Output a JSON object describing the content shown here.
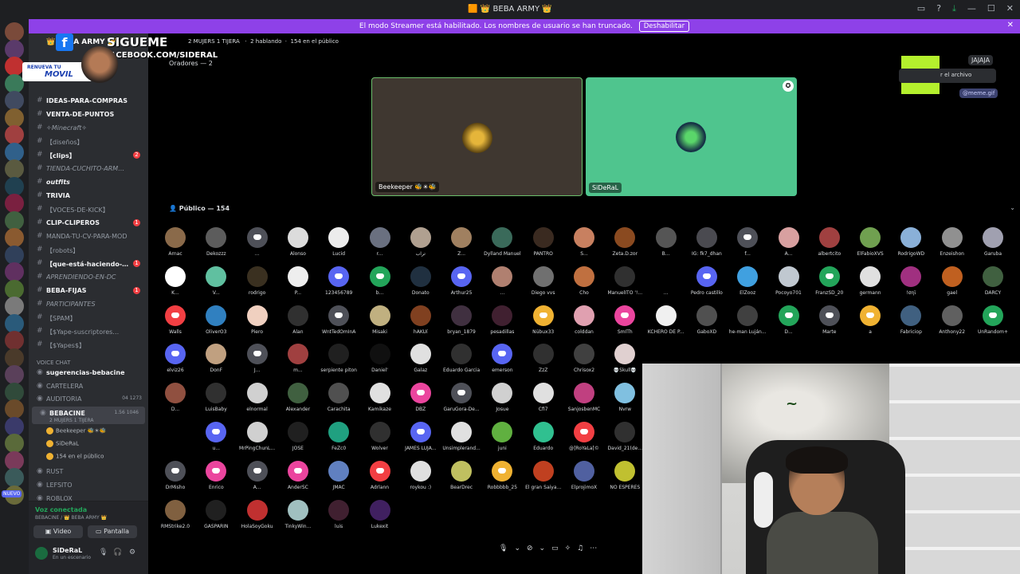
{
  "window": {
    "title": "🟧 👑 BEBA ARMY 👑"
  },
  "streamer_banner": {
    "text": "El modo Streamer está habilitado. Los nombres de usuario se han truncado.",
    "button": "Deshabilitar"
  },
  "overlay": {
    "sigueme": "SIGUEME",
    "facebook": "FACEBOOK.COM/SIDERAL",
    "renueva": "RENUEVA TU",
    "movil": "MOVIL"
  },
  "sidebar": {
    "server_name": "👑 BEBA ARMY 👑",
    "channels": [
      {
        "name": "IDEAS-PARA-COMPRAS",
        "style": "bold"
      },
      {
        "name": "VENTA-DE-PUNTOS",
        "style": "bold"
      },
      {
        "name": "✧Minecraft✧",
        "style": "ital"
      },
      {
        "name": "【diseños】",
        "style": ""
      },
      {
        "name": "【clips】",
        "style": "bold",
        "count": "2"
      },
      {
        "name": "TIENDA-CUCHITO-ARM…",
        "style": "ital"
      },
      {
        "name": "outfits",
        "style": "bold ital"
      },
      {
        "name": "TRIVIA",
        "style": "bold"
      },
      {
        "name": "【VOCES-DE-KICK】",
        "style": ""
      },
      {
        "name": "CLIP-CLIPEROS",
        "style": "bold",
        "count": "1"
      },
      {
        "name": "MANDA-TU-CV-PARA-MOD",
        "style": ""
      },
      {
        "name": "【robots】",
        "style": ""
      },
      {
        "name": "【que-está-haciendo-…",
        "style": "bold",
        "count": "1"
      },
      {
        "name": "APRENDIENDO-EN-DC",
        "style": "ital"
      },
      {
        "name": "BEBA-FIJAS",
        "style": "bold",
        "count": "1"
      },
      {
        "name": "PARTICIPANTES",
        "style": "ital"
      },
      {
        "name": "【SPAM】",
        "style": ""
      },
      {
        "name": "【$Yape-suscriptores…",
        "style": ""
      },
      {
        "name": "【$Yapes$】",
        "style": ""
      }
    ],
    "voice_category": "VOICE CHAT",
    "voice_channels": [
      {
        "name": "sugerencias-bebacine",
        "bold": true
      },
      {
        "name": "CARTELERA",
        "bold": false
      },
      {
        "name": "AUDITORIA",
        "bold": false,
        "num": "04 1273"
      },
      {
        "name": "BEBACINE",
        "bold": true,
        "num": "1.56 1046",
        "sub": "2 MUJERS 1 TIJERA"
      }
    ],
    "voice_users": [
      "Beekeeper 🐝☀🐝",
      "SiDeRaL",
      "154 en el público"
    ],
    "more_channels": [
      "RUST",
      "LEFSITO",
      "ROBLOX"
    ]
  },
  "voice_panel": {
    "connected": "Voz conectada",
    "location": "BEBACINE / 👑 BEBA ARMY 👑",
    "video": "Video",
    "screen": "Pantalla"
  },
  "user_panel": {
    "name": "SiDeRaL",
    "status": "En un escenario"
  },
  "stage": {
    "topic": "2 MUJERS 1 TIJERA",
    "talking": "2 hablando",
    "audience_count": "154 en el público",
    "speakers_header": "Oradores — 2",
    "speakers": [
      "Beekeeper 🐝☀🐝",
      "SiDeRaL"
    ],
    "public_header": "Público — 154"
  },
  "chat_bits": {
    "jajaja": "JAJAJA",
    "file": "r el archivo",
    "meme": "@meme.gif"
  },
  "audience": [
    {
      "n": "Arnac",
      "c": "#8a6a4a"
    },
    {
      "n": "Dekozzz",
      "c": "#5c5c5c"
    },
    {
      "n": "...",
      "c": "#4e5058",
      "d": true
    },
    {
      "n": "Alonso",
      "c": "#dcdcdc"
    },
    {
      "n": "Lucid",
      "c": "#ececec"
    },
    {
      "n": "r...",
      "c": "#6a7080"
    },
    {
      "n": "تراب",
      "c": "#b0a090"
    },
    {
      "n": "Z...",
      "c": "#a08060"
    },
    {
      "n": "Dylland Manuel",
      "c": "#3a6a5a"
    },
    {
      "n": "PANTRO",
      "c": "#3a2a20"
    },
    {
      "n": "S...",
      "c": "#c88060"
    },
    {
      "n": "Zeta.D.zor",
      "c": "#8a4a20"
    },
    {
      "n": "B...",
      "c": "#555555"
    },
    {
      "n": "IG: fk7_dhan",
      "c": "#4a4a50"
    },
    {
      "n": "f...",
      "c": "#4e5058",
      "d": true
    },
    {
      "n": "A...",
      "c": "#d8a0a0"
    },
    {
      "n": "albertcito",
      "c": "#a04040"
    },
    {
      "n": "ElFabioXVS",
      "c": "#70a050"
    },
    {
      "n": "RodrigoWD",
      "c": "#8ab0d8"
    },
    {
      "n": "Enzeishon",
      "c": "#909090"
    },
    {
      "n": "Garuba",
      "c": "#a0a0b0"
    },
    {
      "n": "K...",
      "c": "#ffffff"
    },
    {
      "n": "V...",
      "c": "#60c0a0"
    },
    {
      "n": "rodrigo",
      "c": "#3a3020"
    },
    {
      "n": "P...",
      "c": "#eeeeee"
    },
    {
      "n": "123456789",
      "c": "#5865f2",
      "d": true
    },
    {
      "n": "b...",
      "c": "#23a55a",
      "d": true
    },
    {
      "n": "Donato",
      "c": "#203040"
    },
    {
      "n": "Arthur25",
      "c": "#5865f2",
      "d": true
    },
    {
      "n": "...",
      "c": "#b08070"
    },
    {
      "n": "Diego vvs",
      "c": "#707070"
    },
    {
      "n": "Cho",
      "c": "#c07040"
    },
    {
      "n": "ManuelITO '!...",
      "c": "#303030"
    },
    {
      "n": "...",
      "c": "#000000"
    },
    {
      "n": "Pedro castillo",
      "c": "#5865f2",
      "d": true
    },
    {
      "n": "ElZooz",
      "c": "#40a0e0"
    },
    {
      "n": "Pocoyo701",
      "c": "#c0c8d0"
    },
    {
      "n": "FranzSD_20",
      "c": "#23a55a",
      "d": true
    },
    {
      "n": "germann",
      "c": "#e0e0e0"
    },
    {
      "n": "!σηϊ",
      "c": "#a03080"
    },
    {
      "n": "gael",
      "c": "#c06020"
    },
    {
      "n": "DARCY",
      "c": "#406040"
    },
    {
      "n": "Walls",
      "c": "#f23f43",
      "d": true
    },
    {
      "n": "OliverO3",
      "c": "#3080c0"
    },
    {
      "n": "Piero",
      "c": "#f0d0c0"
    },
    {
      "n": "Alan",
      "c": "#303030"
    },
    {
      "n": "WntTedOmInA",
      "c": "#4e5058",
      "d": true
    },
    {
      "n": "Misaki",
      "c": "#c0b080"
    },
    {
      "n": "hAKUí",
      "c": "#804020"
    },
    {
      "n": "bryan_1879",
      "c": "#403040"
    },
    {
      "n": "pesadillas",
      "c": "#402030"
    },
    {
      "n": "Nübux33",
      "c": "#f0b232",
      "d": true
    },
    {
      "n": "colddan",
      "c": "#e0a0b0"
    },
    {
      "n": "SmITh",
      "c": "#eb459e",
      "d": true
    },
    {
      "n": "KCHERO DE P...",
      "c": "#f0f0f0"
    },
    {
      "n": "GaboXD",
      "c": "#505050"
    },
    {
      "n": "he-man Luján...",
      "c": "#404040"
    },
    {
      "n": "D...",
      "c": "#23a55a",
      "d": true
    },
    {
      "n": "Marte",
      "c": "#4e5058",
      "d": true
    },
    {
      "n": "a",
      "c": "#f0b232",
      "d": true
    },
    {
      "n": "Fabriciop",
      "c": "#406080"
    },
    {
      "n": "Anthony22",
      "c": "#606060"
    },
    {
      "n": "UnRandom+",
      "c": "#23a55a",
      "d": true
    },
    {
      "n": "elviz26",
      "c": "#5865f2",
      "d": true
    },
    {
      "n": "DonF",
      "c": "#c0a080"
    },
    {
      "n": "J...",
      "c": "#4e5058",
      "d": true
    },
    {
      "n": "m...",
      "c": "#a04040"
    },
    {
      "n": "serpiente piton",
      "c": "#202020"
    },
    {
      "n": "Daniel'",
      "c": "#101010"
    },
    {
      "n": "Galaz",
      "c": "#e0e0e0"
    },
    {
      "n": "Eduardo Garcia",
      "c": "#303030"
    },
    {
      "n": "emerson",
      "c": "#5865f2",
      "d": true
    },
    {
      "n": "ZzZ",
      "c": "#303030"
    },
    {
      "n": "Chrisox2",
      "c": "#404040"
    },
    {
      "n": "💀Skull💀",
      "c": "#e0d0d0"
    },
    {
      "n": "D...",
      "c": "#905040"
    },
    {
      "n": "LuisBaby",
      "c": "#303030"
    },
    {
      "n": "elnormal",
      "c": "#d0d0d0"
    },
    {
      "n": "Alexander",
      "c": "#406040"
    },
    {
      "n": "Carachita",
      "c": "#505050"
    },
    {
      "n": "Kamikaze",
      "c": "#e0e0e0"
    },
    {
      "n": "DBZ",
      "c": "#eb459e",
      "d": true
    },
    {
      "n": "GaruGora-De...",
      "c": "#4e5058",
      "d": true
    },
    {
      "n": "Josue",
      "c": "#d0d0d0"
    },
    {
      "n": "Cfi7",
      "c": "#e0e0e0"
    },
    {
      "n": "SanjosbenMC",
      "c": "#c04080"
    },
    {
      "n": "Nvrw",
      "c": "#80c0e0"
    },
    {
      "n": "u...",
      "c": "#5865f2",
      "d": true
    },
    {
      "n": "MrPingChunL...",
      "c": "#d0d0d0"
    },
    {
      "n": "JOSE",
      "c": "#202020"
    },
    {
      "n": "FeZc0",
      "c": "#20a080"
    },
    {
      "n": "Wolver",
      "c": "#303030"
    },
    {
      "n": "JAMES LUJA...",
      "c": "#5865f2",
      "d": true
    },
    {
      "n": "Unsimplerand...",
      "c": "#e0e0e0"
    },
    {
      "n": "juni",
      "c": "#60b040"
    },
    {
      "n": "Eduardo",
      "c": "#30c090"
    },
    {
      "n": "@]RoYaLa[©",
      "c": "#f23f43",
      "d": true
    },
    {
      "n": "David_21(de...",
      "c": "#303030"
    },
    {
      "n": "DrMisho",
      "c": "#4e5058",
      "d": true
    },
    {
      "n": "Enrico",
      "c": "#eb459e",
      "d": true
    },
    {
      "n": "A...",
      "c": "#4e5058",
      "d": true
    },
    {
      "n": "AnderSC",
      "c": "#eb459e",
      "d": true
    },
    {
      "n": "JMAC",
      "c": "#6080c0"
    },
    {
      "n": "Adrlann",
      "c": "#f23f43",
      "d": true
    },
    {
      "n": "roykou :)",
      "c": "#e0e0e0"
    },
    {
      "n": "BearDrec",
      "c": "#c0c060"
    },
    {
      "n": "Robbbbb_25",
      "c": "#f0b232",
      "d": true
    },
    {
      "n": "El gran Saiya...",
      "c": "#c04020"
    },
    {
      "n": "ElprojimoX",
      "c": "#5060a0"
    },
    {
      "n": "NO ESPERES",
      "c": "#c0c030"
    },
    {
      "n": "RMStrike2.0",
      "c": "#806040"
    },
    {
      "n": "GASPARIN",
      "c": "#202020"
    },
    {
      "n": "HolaSoyGoku",
      "c": "#c03030"
    },
    {
      "n": "TinkyWin...",
      "c": "#a0c0c0"
    },
    {
      "n": "luis",
      "c": "#402030"
    },
    {
      "n": "Lukexit",
      "c": "#402060"
    }
  ]
}
